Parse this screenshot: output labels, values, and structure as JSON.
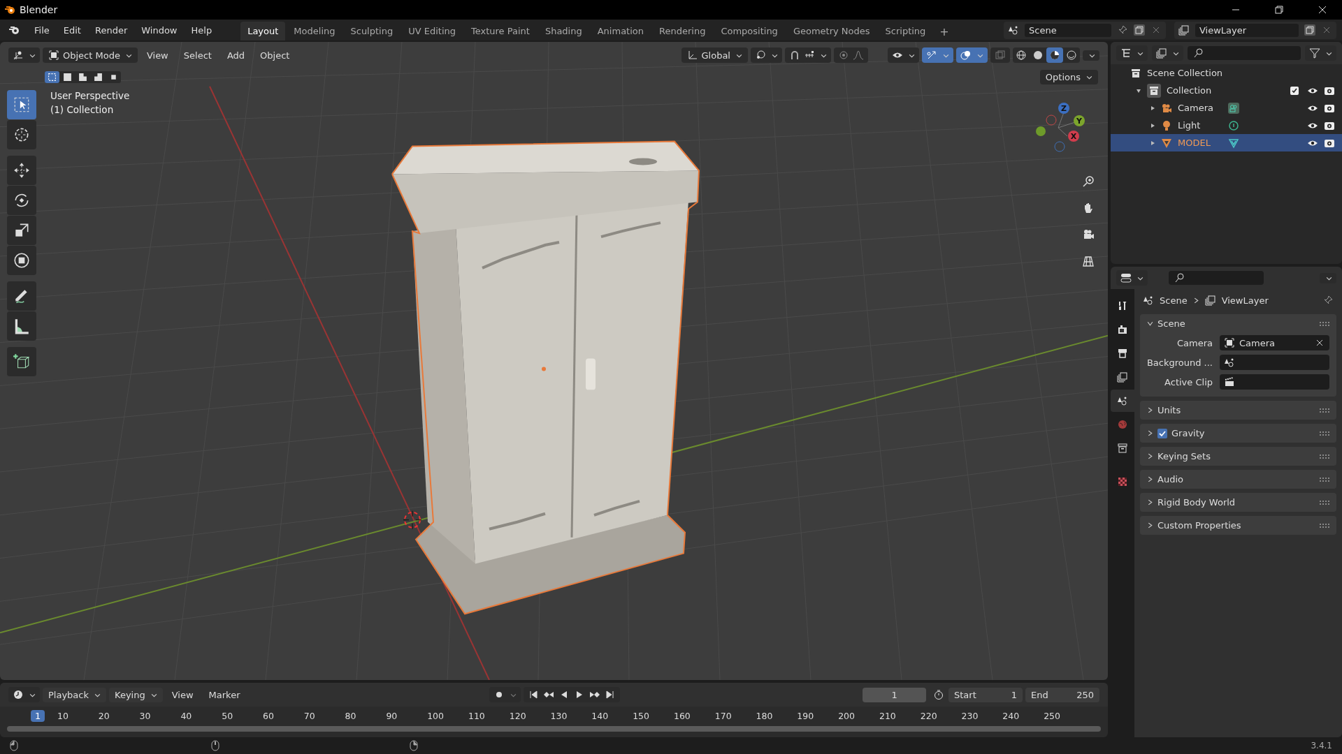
{
  "window": {
    "title": "Blender"
  },
  "menu": [
    "File",
    "Edit",
    "Render",
    "Window",
    "Help"
  ],
  "workspaces": [
    {
      "label": "Layout",
      "selected": true
    },
    {
      "label": "Modeling",
      "selected": false
    },
    {
      "label": "Sculpting",
      "selected": false
    },
    {
      "label": "UV Editing",
      "selected": false
    },
    {
      "label": "Texture Paint",
      "selected": false
    },
    {
      "label": "Shading",
      "selected": false
    },
    {
      "label": "Animation",
      "selected": false
    },
    {
      "label": "Rendering",
      "selected": false
    },
    {
      "label": "Compositing",
      "selected": false
    },
    {
      "label": "Geometry Nodes",
      "selected": false
    },
    {
      "label": "Scripting",
      "selected": false
    }
  ],
  "add_workspace": "+",
  "scene": "Scene",
  "view_layer": "ViewLayer",
  "viewport": {
    "mode": "Object Mode",
    "menus": [
      "View",
      "Select",
      "Add",
      "Object"
    ],
    "orientation": "Global",
    "options": "Options",
    "view_name": "User Perspective",
    "collection": "(1) Collection",
    "toggles": [
      {
        "kind": "gizmo",
        "on": true
      },
      {
        "kind": "overlay",
        "on": true
      },
      {
        "kind": "xray",
        "on": false
      }
    ],
    "shading": [
      {
        "kind": "wireframe",
        "selected": false
      },
      {
        "kind": "solid",
        "selected": false
      },
      {
        "kind": "material",
        "selected": true
      },
      {
        "kind": "rendered",
        "selected": false
      }
    ],
    "select_modes": [
      {
        "selected": true
      },
      {
        "selected": false
      },
      {
        "selected": false
      },
      {
        "selected": false
      },
      {
        "selected": false
      }
    ],
    "tools": [
      {
        "kind": "select",
        "selected": true
      },
      {
        "kind": "cursor",
        "selected": false
      },
      {
        "kind": "move",
        "selected": false
      },
      {
        "kind": "rotate",
        "selected": false
      },
      {
        "kind": "scale",
        "selected": false
      },
      {
        "kind": "transform",
        "selected": false
      },
      {
        "kind": "annotate",
        "selected": false
      },
      {
        "kind": "measure",
        "selected": false
      },
      {
        "kind": "add-cube",
        "selected": false
      }
    ],
    "axes": [
      "Z",
      "Y",
      "X"
    ]
  },
  "outliner": {
    "root": "Scene Collection",
    "children": [
      {
        "name": "Collection",
        "kind": "collection",
        "expanded": true,
        "checked": true,
        "selected": false,
        "children": [
          {
            "name": "Camera",
            "kind": "camera",
            "expanded": false,
            "selected": false
          },
          {
            "name": "Light",
            "kind": "light",
            "expanded": false,
            "selected": false
          },
          {
            "name": "MODEL",
            "kind": "mesh",
            "expanded": false,
            "selected": true
          }
        ]
      }
    ]
  },
  "properties": {
    "tabs": [
      {
        "kind": "tool",
        "selected": false
      },
      {
        "kind": "render",
        "selected": false
      },
      {
        "kind": "output",
        "selected": false
      },
      {
        "kind": "view-layer",
        "selected": false
      },
      {
        "kind": "scene",
        "selected": true
      },
      {
        "kind": "world",
        "selected": false
      },
      {
        "kind": "collection",
        "selected": false
      },
      {
        "kind": "texture",
        "selected": false
      }
    ],
    "breadcrumb": [
      "Scene",
      "ViewLayer"
    ],
    "panels": [
      {
        "title": "Scene",
        "expanded": true,
        "fields": [
          {
            "label": "Camera",
            "kind": "camera",
            "value": "Camera"
          },
          {
            "label": "Background ...",
            "kind": "scene"
          },
          {
            "label": "Active Clip",
            "kind": "clip"
          }
        ]
      },
      {
        "title": "Units",
        "expanded": false
      },
      {
        "title": "Gravity",
        "expanded": false,
        "kind": "checkbox",
        "checked": true
      },
      {
        "title": "Keying Sets",
        "expanded": false
      },
      {
        "title": "Audio",
        "expanded": false
      },
      {
        "title": "Rigid Body World",
        "expanded": false
      },
      {
        "title": "Custom Properties",
        "expanded": false
      }
    ]
  },
  "timeline": {
    "menus": [
      "Playback",
      "Keying",
      "View",
      "Marker"
    ],
    "current_frame": "1",
    "start_label": "Start",
    "start": "1",
    "end_label": "End",
    "end": "250",
    "playhead": "1",
    "ruler": [
      "10",
      "20",
      "30",
      "40",
      "50",
      "60",
      "70",
      "80",
      "90",
      "100",
      "110",
      "120",
      "130",
      "140",
      "150",
      "160",
      "170",
      "180",
      "190",
      "200",
      "210",
      "220",
      "230",
      "240",
      "250"
    ]
  },
  "status_bar": {
    "version": "3.4.1"
  }
}
